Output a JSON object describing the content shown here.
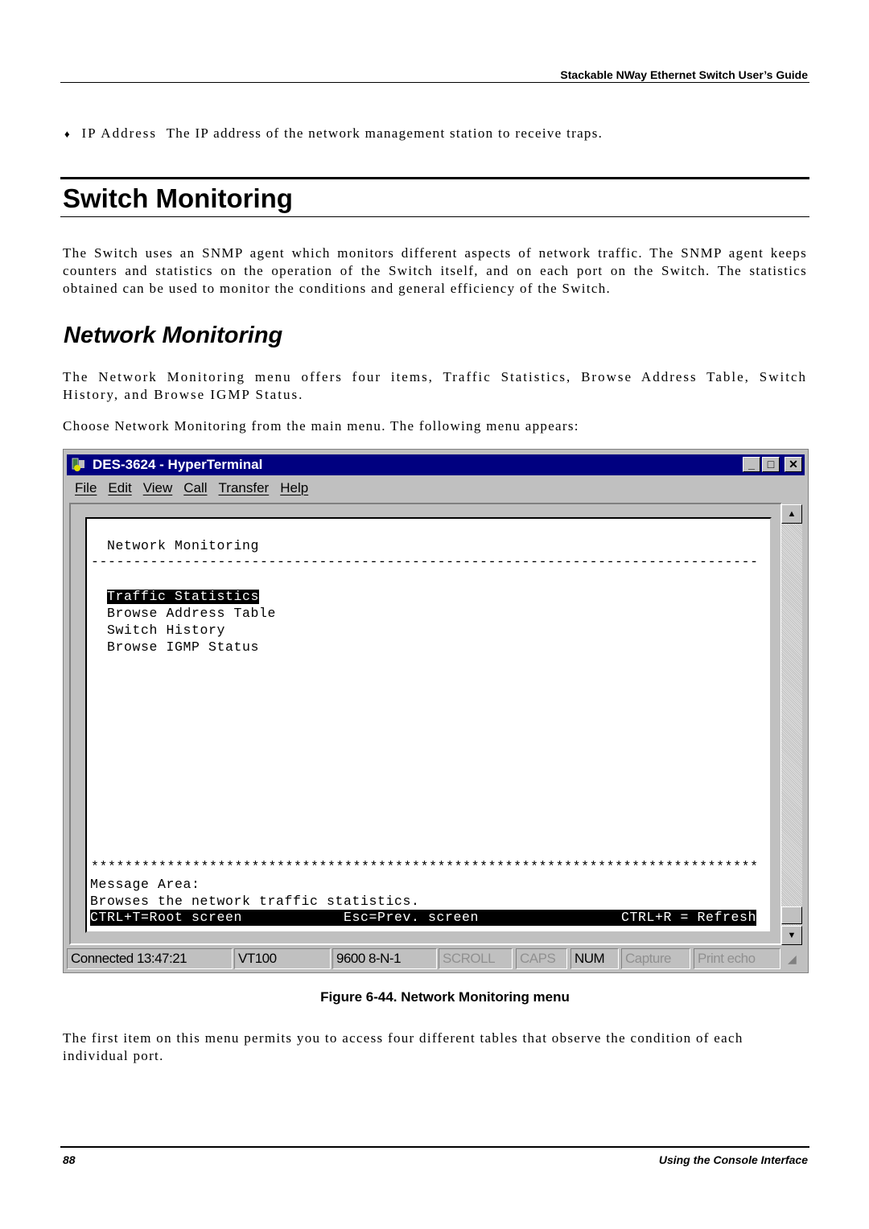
{
  "header": {
    "title": "Stackable NWay Ethernet Switch User’s Guide"
  },
  "bullet": {
    "term": "IP Address",
    "text": "The IP address of the network management station to receive traps."
  },
  "section": {
    "title": "Switch Monitoring",
    "paragraph": "The Switch uses an SNMP agent which monitors different aspects of network traffic. The SNMP agent keeps counters and statistics on the operation of the Switch itself, and on each port on the Switch. The statistics obtained can be used to monitor the conditions and general efficiency of the Switch."
  },
  "subsection": {
    "title": "Network Monitoring",
    "paragraph1": "The Network Monitoring menu offers four items, Traffic Statistics, Browse Address Table, Switch History, and Browse IGMP Status.",
    "paragraph2": "Choose Network Monitoring from the main menu. The following menu appears:"
  },
  "window": {
    "title": "DES-3624 - HyperTerminal",
    "menu": [
      "File",
      "Edit",
      "View",
      "Call",
      "Transfer",
      "Help"
    ],
    "terminal": {
      "heading": "Network Monitoring",
      "dashes": "-------------------------------------------------------------------------------",
      "items": [
        "Traffic Statistics",
        "Browse Address Table",
        "Switch History",
        "Browse IGMP Status"
      ],
      "selected_index": 0,
      "stars": "*******************************************************************************",
      "message_label": "Message Area:",
      "message": "Browses the network traffic statistics.",
      "footer": {
        "left": "CTRL+T=Root screen",
        "center": "Esc=Prev. screen",
        "right": "CTRL+R = Refresh"
      }
    },
    "status": [
      "Connected 13:47:21",
      "VT100",
      "9600 8-N-1",
      "SCROLL",
      "CAPS",
      "NUM",
      "Capture",
      "Print echo"
    ]
  },
  "caption": "Figure 6-44.  Network Monitoring menu",
  "closing": "The first item on this menu permits you to access four different tables that observe the condition of each individual port.",
  "footer": {
    "page": "88",
    "title": "Using the Console Interface"
  }
}
